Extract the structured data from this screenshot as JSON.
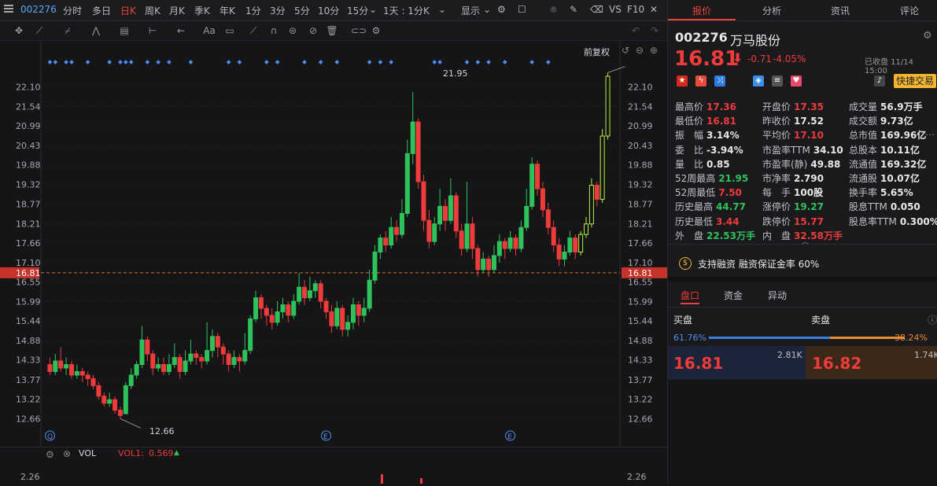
{
  "topbar": {
    "code": "002276",
    "periods": [
      "分时",
      "多日",
      "日K",
      "周K",
      "月K",
      "季K",
      "年K",
      "1分",
      "3分",
      "5分",
      "10分",
      "15分"
    ],
    "active_period": "日K",
    "interval_select": "1天 : 1分K",
    "display_label": "显示",
    "right_labels": [
      "VS",
      "F10"
    ]
  },
  "chart": {
    "adjust_label": "前复权",
    "high_label": "21.95",
    "low_label": "12.66",
    "current_price": "16.81",
    "price_ticks": [
      "22.10",
      "21.54",
      "20.99",
      "20.43",
      "19.88",
      "19.32",
      "18.77",
      "18.21",
      "17.66",
      "17.10",
      "16.55",
      "15.99",
      "15.44",
      "14.88",
      "14.33",
      "13.77",
      "13.22",
      "12.66"
    ],
    "event_markers": [
      "Q",
      "E",
      "E"
    ],
    "vol_label": "VOL",
    "vol1_label": "VOL1:",
    "vol1_value": "0.569",
    "vol_tick": "2.26"
  },
  "chart_data": {
    "type": "candlestick",
    "ylim": [
      12.4,
      22.4
    ],
    "note_current": 16.81,
    "candles": [
      [
        14.2,
        14.0,
        14.4,
        13.9
      ],
      [
        14.0,
        14.3,
        14.5,
        13.9
      ],
      [
        14.3,
        14.1,
        14.7,
        14.0
      ],
      [
        14.1,
        14.2,
        14.4,
        13.9
      ],
      [
        14.2,
        13.9,
        14.3,
        13.8
      ],
      [
        13.9,
        14.0,
        14.2,
        13.8
      ],
      [
        14.0,
        13.9,
        14.1,
        13.7
      ],
      [
        13.9,
        13.8,
        14.0,
        13.6
      ],
      [
        13.8,
        13.6,
        13.9,
        13.5
      ],
      [
        13.6,
        13.3,
        13.7,
        13.2
      ],
      [
        13.3,
        13.1,
        13.4,
        13.0
      ],
      [
        13.1,
        13.2,
        13.4,
        13.0
      ],
      [
        13.2,
        12.9,
        13.3,
        12.8
      ],
      [
        12.9,
        12.75,
        13.0,
        12.66
      ],
      [
        12.8,
        13.6,
        13.7,
        12.8
      ],
      [
        13.6,
        13.9,
        14.1,
        13.5
      ],
      [
        13.9,
        14.2,
        14.3,
        13.8
      ],
      [
        14.2,
        14.9,
        15.3,
        14.1
      ],
      [
        14.9,
        14.5,
        15.0,
        14.3
      ],
      [
        14.5,
        14.1,
        14.6,
        13.9
      ],
      [
        14.1,
        14.2,
        14.4,
        14.0
      ],
      [
        14.2,
        14.0,
        14.4,
        13.9
      ],
      [
        14.0,
        14.2,
        14.5,
        13.9
      ],
      [
        14.2,
        14.4,
        14.8,
        14.1
      ],
      [
        14.4,
        14.0,
        14.5,
        13.8
      ],
      [
        14.0,
        14.3,
        14.6,
        13.9
      ],
      [
        14.3,
        14.5,
        14.9,
        14.2
      ],
      [
        14.5,
        14.4,
        14.6,
        14.2
      ],
      [
        14.4,
        14.3,
        14.5,
        14.1
      ],
      [
        14.3,
        14.6,
        15.4,
        14.2
      ],
      [
        14.6,
        15.0,
        15.2,
        14.4
      ],
      [
        15.0,
        14.7,
        15.1,
        14.4
      ],
      [
        14.7,
        14.5,
        14.8,
        14.2
      ],
      [
        14.5,
        14.2,
        14.6,
        14.0
      ],
      [
        14.2,
        14.4,
        14.6,
        14.1
      ],
      [
        14.4,
        14.3,
        14.5,
        14.0
      ],
      [
        14.3,
        14.6,
        15.1,
        14.2
      ],
      [
        14.6,
        15.5,
        15.6,
        14.5
      ],
      [
        15.5,
        16.1,
        16.3,
        15.4
      ],
      [
        16.1,
        15.8,
        16.2,
        15.5
      ],
      [
        15.8,
        15.6,
        15.9,
        15.3
      ],
      [
        15.6,
        15.4,
        15.8,
        15.2
      ],
      [
        15.4,
        15.7,
        16.0,
        15.3
      ],
      [
        15.7,
        15.9,
        16.1,
        15.5
      ],
      [
        15.9,
        15.6,
        16.0,
        15.4
      ],
      [
        15.6,
        16.0,
        16.2,
        15.5
      ],
      [
        16.0,
        16.4,
        16.8,
        15.9
      ],
      [
        16.4,
        16.1,
        16.6,
        15.9
      ],
      [
        16.1,
        16.3,
        16.7,
        16.0
      ],
      [
        16.3,
        16.5,
        16.6,
        16.1
      ],
      [
        16.5,
        16.0,
        16.6,
        15.8
      ],
      [
        16.0,
        15.7,
        16.1,
        15.5
      ],
      [
        15.7,
        15.3,
        15.9,
        15.1
      ],
      [
        15.3,
        15.8,
        16.0,
        15.2
      ],
      [
        15.8,
        15.2,
        15.9,
        15.0
      ],
      [
        15.2,
        15.4,
        15.6,
        15.0
      ],
      [
        15.4,
        15.9,
        16.1,
        15.2
      ],
      [
        15.9,
        15.6,
        16.0,
        15.3
      ],
      [
        15.6,
        15.8,
        16.1,
        15.4
      ],
      [
        15.8,
        16.6,
        16.9,
        15.7
      ],
      [
        16.6,
        17.4,
        17.6,
        16.5
      ],
      [
        17.4,
        17.8,
        17.9,
        17.2
      ],
      [
        17.8,
        17.6,
        18.0,
        17.4
      ],
      [
        17.6,
        18.1,
        18.4,
        17.5
      ],
      [
        18.1,
        17.9,
        18.3,
        17.7
      ],
      [
        17.9,
        18.5,
        18.9,
        17.8
      ],
      [
        18.5,
        20.2,
        20.6,
        18.4
      ],
      [
        20.2,
        21.1,
        21.95,
        19.9
      ],
      [
        21.1,
        19.4,
        21.2,
        19.2
      ],
      [
        19.4,
        18.3,
        19.6,
        18.0
      ],
      [
        18.3,
        17.7,
        18.6,
        17.5
      ],
      [
        17.7,
        18.2,
        18.4,
        17.6
      ],
      [
        18.2,
        18.7,
        19.2,
        18.0
      ],
      [
        18.7,
        18.3,
        18.9,
        18.0
      ],
      [
        18.3,
        19.0,
        19.5,
        18.2
      ],
      [
        19.0,
        18.0,
        19.1,
        17.8
      ],
      [
        18.0,
        17.5,
        18.2,
        17.3
      ],
      [
        17.5,
        18.2,
        19.4,
        17.4
      ],
      [
        18.2,
        17.5,
        18.4,
        17.2
      ],
      [
        17.5,
        16.9,
        17.6,
        16.7
      ],
      [
        16.9,
        17.2,
        17.4,
        16.8
      ],
      [
        17.2,
        16.9,
        17.3,
        16.7
      ],
      [
        16.9,
        17.3,
        17.6,
        16.8
      ],
      [
        17.3,
        17.7,
        17.9,
        17.1
      ],
      [
        17.7,
        17.5,
        17.8,
        17.2
      ],
      [
        17.5,
        17.8,
        18.0,
        17.4
      ],
      [
        17.8,
        17.5,
        17.9,
        17.3
      ],
      [
        17.5,
        18.1,
        18.3,
        17.4
      ],
      [
        18.1,
        18.7,
        19.2,
        18.0
      ],
      [
        18.7,
        19.9,
        20.1,
        18.6
      ],
      [
        19.9,
        19.2,
        20.0,
        19.0
      ],
      [
        19.2,
        18.6,
        19.4,
        18.4
      ],
      [
        18.6,
        18.1,
        18.8,
        17.9
      ],
      [
        18.1,
        17.6,
        18.3,
        17.4
      ],
      [
        17.6,
        17.2,
        17.8,
        17.0
      ],
      [
        17.2,
        17.4,
        17.6,
        17.0
      ],
      [
        17.4,
        17.8,
        18.0,
        17.3
      ],
      [
        17.8,
        17.4,
        17.9,
        17.2
      ],
      [
        17.4,
        17.9,
        18.0,
        17.3
      ],
      [
        17.9,
        18.2,
        18.4,
        17.8
      ],
      [
        18.2,
        19.3,
        19.5,
        18.1
      ],
      [
        19.3,
        18.9,
        19.4,
        18.7
      ],
      [
        18.9,
        20.7,
        20.9,
        18.8
      ],
      [
        20.7,
        22.4,
        22.5,
        20.6
      ]
    ]
  },
  "quote": {
    "code": "002276",
    "name": "万马股份",
    "price": "16.81",
    "change": "-0.71",
    "change_pct": "-4.05%",
    "status": "已收盘 11/14 15:00",
    "quick_trade": "快捷交易",
    "stats": [
      [
        {
          "l": "最高价",
          "v": "17.36",
          "c": "red"
        },
        {
          "l": "开盘价",
          "v": "17.35",
          "c": "red"
        },
        {
          "l": "成交量",
          "v": "56.9万手",
          "c": "white"
        }
      ],
      [
        {
          "l": "最低价",
          "v": "16.81",
          "c": "red"
        },
        {
          "l": "昨收价",
          "v": "17.52",
          "c": "white"
        },
        {
          "l": "成交额",
          "v": "9.73亿",
          "c": "white"
        }
      ],
      [
        {
          "l": "振　幅",
          "v": "3.14%",
          "c": "white"
        },
        {
          "l": "平均价",
          "v": "17.10",
          "c": "red"
        },
        {
          "l": "总市值",
          "v": "169.96亿",
          "c": "white"
        }
      ],
      [
        {
          "l": "委　比",
          "v": "-3.94%",
          "c": "white"
        },
        {
          "l": "市盈率TTM",
          "v": "34.10",
          "c": "white"
        },
        {
          "l": "总股本",
          "v": "10.11亿",
          "c": "white"
        }
      ],
      [
        {
          "l": "量　比",
          "v": "0.85",
          "c": "white"
        },
        {
          "l": "市盈率(静)",
          "v": "49.88",
          "c": "white"
        },
        {
          "l": "流通值",
          "v": "169.32亿",
          "c": "white"
        }
      ],
      [
        {
          "l": "52周最高",
          "v": "21.95",
          "c": "green"
        },
        {
          "l": "市净率",
          "v": "2.790",
          "c": "white"
        },
        {
          "l": "流通股",
          "v": "10.07亿",
          "c": "white"
        }
      ],
      [
        {
          "l": "52周最低",
          "v": "7.50",
          "c": "red"
        },
        {
          "l": "每　手",
          "v": "100股",
          "c": "white"
        },
        {
          "l": "换手率",
          "v": "5.65%",
          "c": "white"
        }
      ],
      [
        {
          "l": "历史最高",
          "v": "44.77",
          "c": "green"
        },
        {
          "l": "涨停价",
          "v": "19.27",
          "c": "green"
        },
        {
          "l": "股息TTM",
          "v": "0.050",
          "c": "white"
        }
      ],
      [
        {
          "l": "历史最低",
          "v": "3.44",
          "c": "red"
        },
        {
          "l": "跌停价",
          "v": "15.77",
          "c": "red"
        },
        {
          "l": "股息率TTM",
          "v": "0.300%",
          "c": "white"
        }
      ],
      [
        {
          "l": "外　盘",
          "v": "22.53万手",
          "c": "green"
        },
        {
          "l": "内　盘",
          "v": "32.58万手",
          "c": "red"
        }
      ]
    ],
    "margin_text": "支持融资 融资保证金率 60%"
  },
  "tabs": [
    "报价",
    "分析",
    "资讯",
    "评论"
  ],
  "sub_tabs": [
    "盘口",
    "资金",
    "异动"
  ],
  "order_book": {
    "buy_label": "买盘",
    "sell_label": "卖盘",
    "buy_pct": "61.76%",
    "sell_pct": "38.24%",
    "buy_ratio": 0.6176,
    "bid_price": "16.81",
    "bid_vol": "2.81K",
    "ask_price": "16.82",
    "ask_vol": "1.74K"
  }
}
